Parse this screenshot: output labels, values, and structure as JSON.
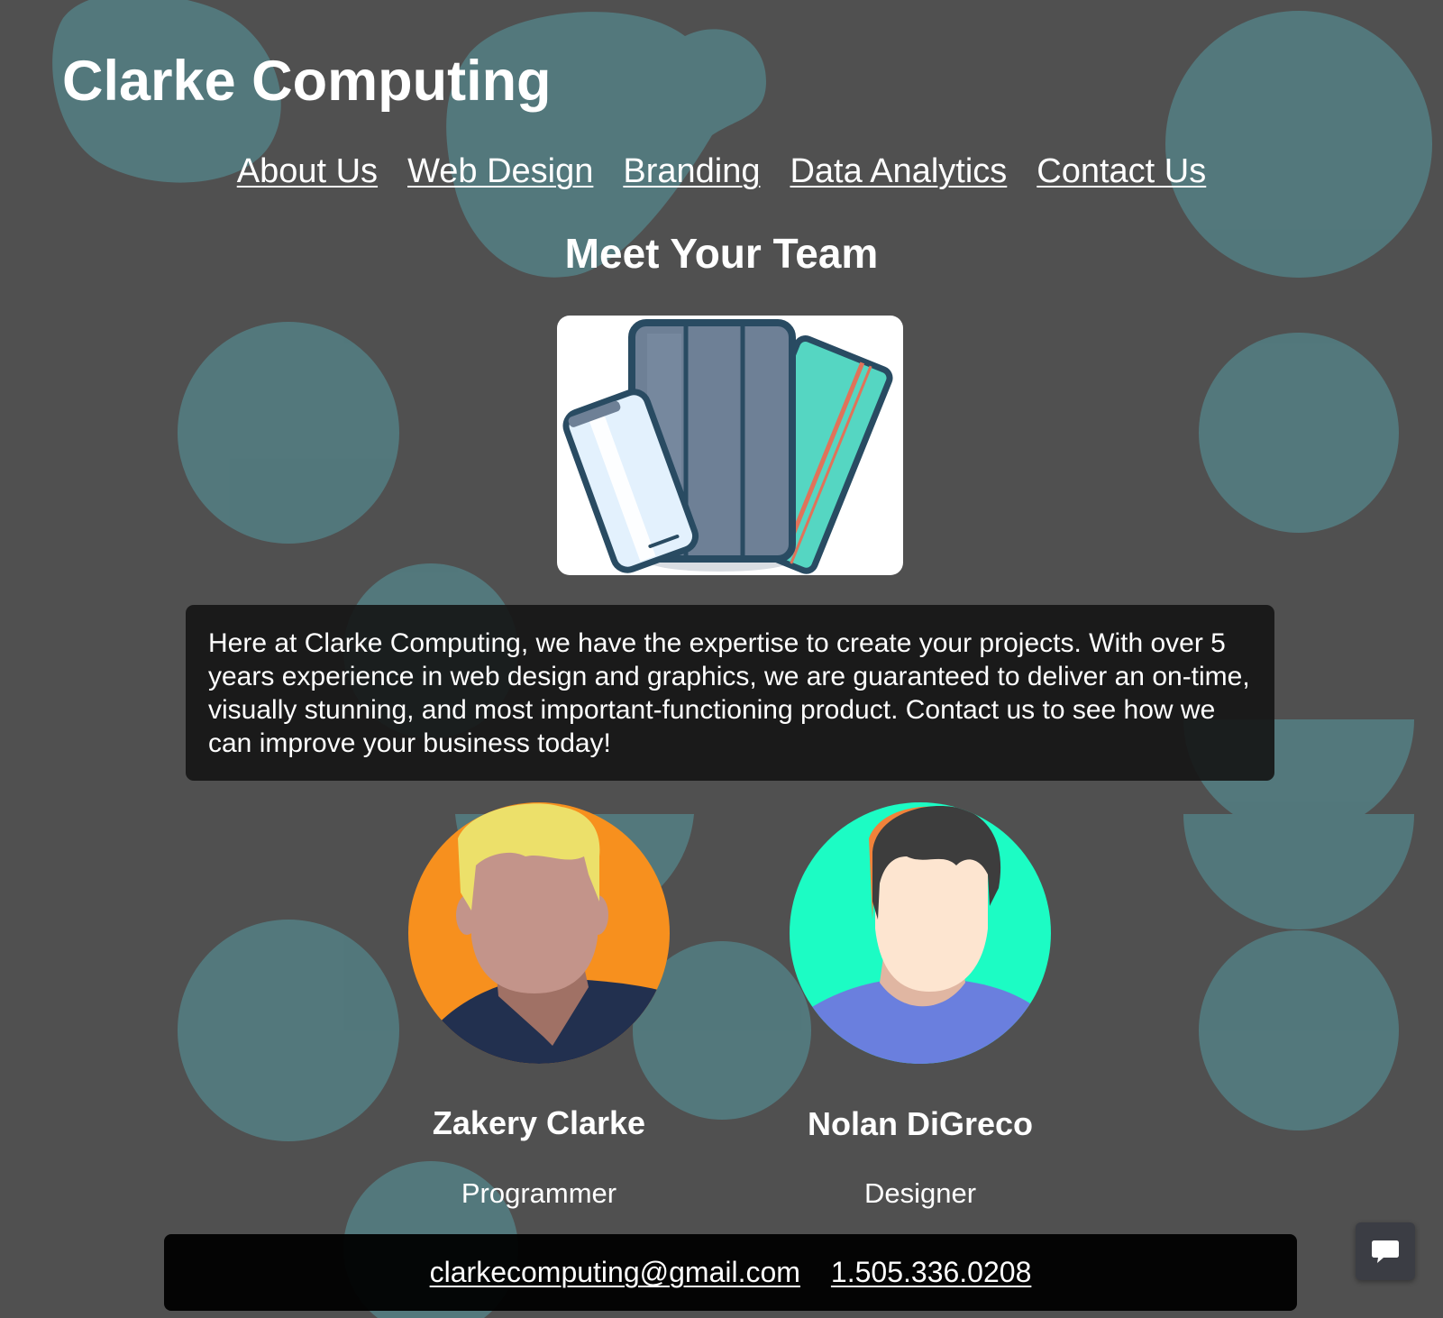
{
  "site": {
    "title": "Clarke Computing"
  },
  "nav": {
    "items": [
      {
        "label": "About Us"
      },
      {
        "label": "Web Design"
      },
      {
        "label": "Branding"
      },
      {
        "label": "Data Analytics"
      },
      {
        "label": "Contact Us"
      }
    ]
  },
  "main": {
    "heading": "Meet Your Team",
    "hero_image_icon": "devices-illustration",
    "about_text": "Here at Clarke Computing, we have the expertise to create your projects. With over 5 years experience in web design and graphics, we are guaranteed to deliver an on-time, visually stunning, and most important-functioning product. Contact us to see how we can improve your business today!",
    "team": [
      {
        "name": "Zakery Clarke",
        "role": "Programmer",
        "avatar_bg": "#f7901e"
      },
      {
        "name": "Nolan DiGreco",
        "role": "Designer",
        "avatar_bg": "#1cfcc4"
      }
    ]
  },
  "footer": {
    "email": "clarkecomputing@gmail.com",
    "phone": "1.505.336.0208"
  },
  "chat": {
    "icon": "chat-bubble-icon"
  },
  "colors": {
    "background": "#505050",
    "blob": "#537a7e",
    "text": "#ffffff"
  }
}
